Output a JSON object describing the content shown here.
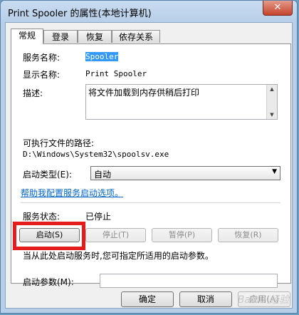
{
  "window": {
    "title": "Print Spooler 的属性(本地计算机)",
    "close_glyph": "✕"
  },
  "tabs": [
    {
      "label": "常规",
      "active": true
    },
    {
      "label": "登录",
      "active": false
    },
    {
      "label": "恢复",
      "active": false
    },
    {
      "label": "依存关系",
      "active": false
    }
  ],
  "general": {
    "service_name_label": "服务名称:",
    "service_name_value": "Spooler",
    "display_name_label": "显示名称:",
    "display_name_value": "Print Spooler",
    "description_label": "描述:",
    "description_value": "将文件加载到内存供稍后打印",
    "exe_path_label": "可执行文件的路径:",
    "exe_path_value": "D:\\Windows\\System32\\spoolsv.exe",
    "startup_type_label": "启动类型(E):",
    "startup_type_value": "自动",
    "help_link": "帮助我配置服务启动选项。",
    "status_label": "服务状态:",
    "status_value": "已停止",
    "start_button": "启动(S)",
    "stop_button": "停止(T)",
    "pause_button": "暂停(P)",
    "resume_button": "恢复(R)",
    "hint_text": "当从此处启动服务时,您可指定所适用的启动参数。",
    "params_label": "启动参数(M):",
    "params_value": ""
  },
  "footer": {
    "ok_button": "确定",
    "cancel_button": "取消",
    "apply_button": "应用(A)"
  },
  "watermark": "Baidu 经验",
  "colors": {
    "selection": "#3399ff",
    "link": "#0066cc",
    "highlight_box": "#e51c1c"
  }
}
